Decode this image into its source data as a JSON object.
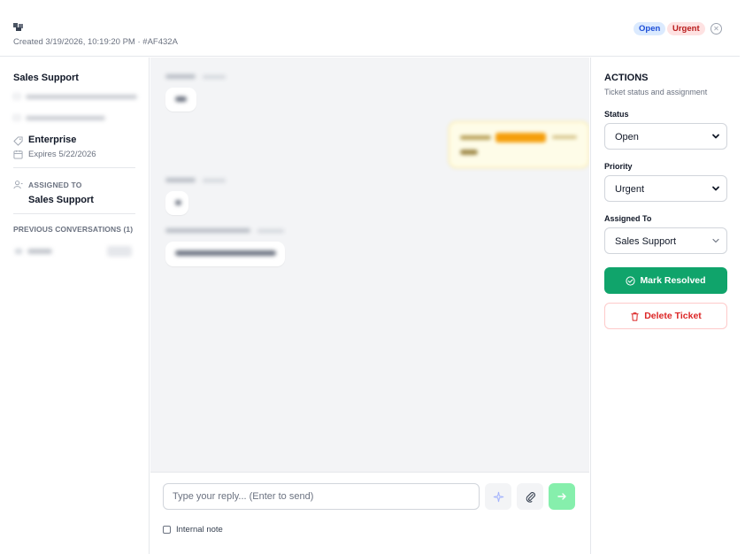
{
  "header": {
    "created_text": "Created 3/19/2026, 10:19:20 PM  ·  #AF432A",
    "status_badge": "Open",
    "priority_badge": "Urgent",
    "icons": {
      "app": "ticket-glyph-icon",
      "close": "close-circle-icon"
    }
  },
  "customer": {
    "name": "Sales Support",
    "plan": "Enterprise",
    "expires": "Expires 5/22/2026",
    "assigned_label": "ASSIGNED TO",
    "assigned_value": "Sales Support",
    "previous_label": "PREVIOUS CONVERSATIONS (1)",
    "icons": {
      "email": "mail-icon",
      "phone": "phone-icon",
      "plan": "tag-icon",
      "expires": "calendar-icon",
      "assigned": "user-icon"
    }
  },
  "composer": {
    "placeholder": "Type your reply... (Enter to send)",
    "internal_note_label": "Internal note",
    "icons": {
      "ai": "sparkle-icon",
      "attach": "paperclip-icon",
      "send": "arrow-right-icon"
    }
  },
  "actions": {
    "title": "ACTIONS",
    "subtitle": "Ticket status and assignment",
    "status_label": "Status",
    "status_value": "Open",
    "priority_label": "Priority",
    "priority_value": "Urgent",
    "assigned_label": "Assigned To",
    "assigned_value": "Sales Support",
    "resolve_label": "Mark Resolved",
    "delete_label": "Delete Ticket"
  },
  "colors": {
    "resolve_green": "#10a46b",
    "delete_red": "#dc2626",
    "open_badge_bg": "#dbeafe",
    "urgent_badge_bg": "#fee2e2",
    "send_button": "#86efac",
    "note_bg": "#fefce8",
    "note_tag": "#f59e0b"
  }
}
